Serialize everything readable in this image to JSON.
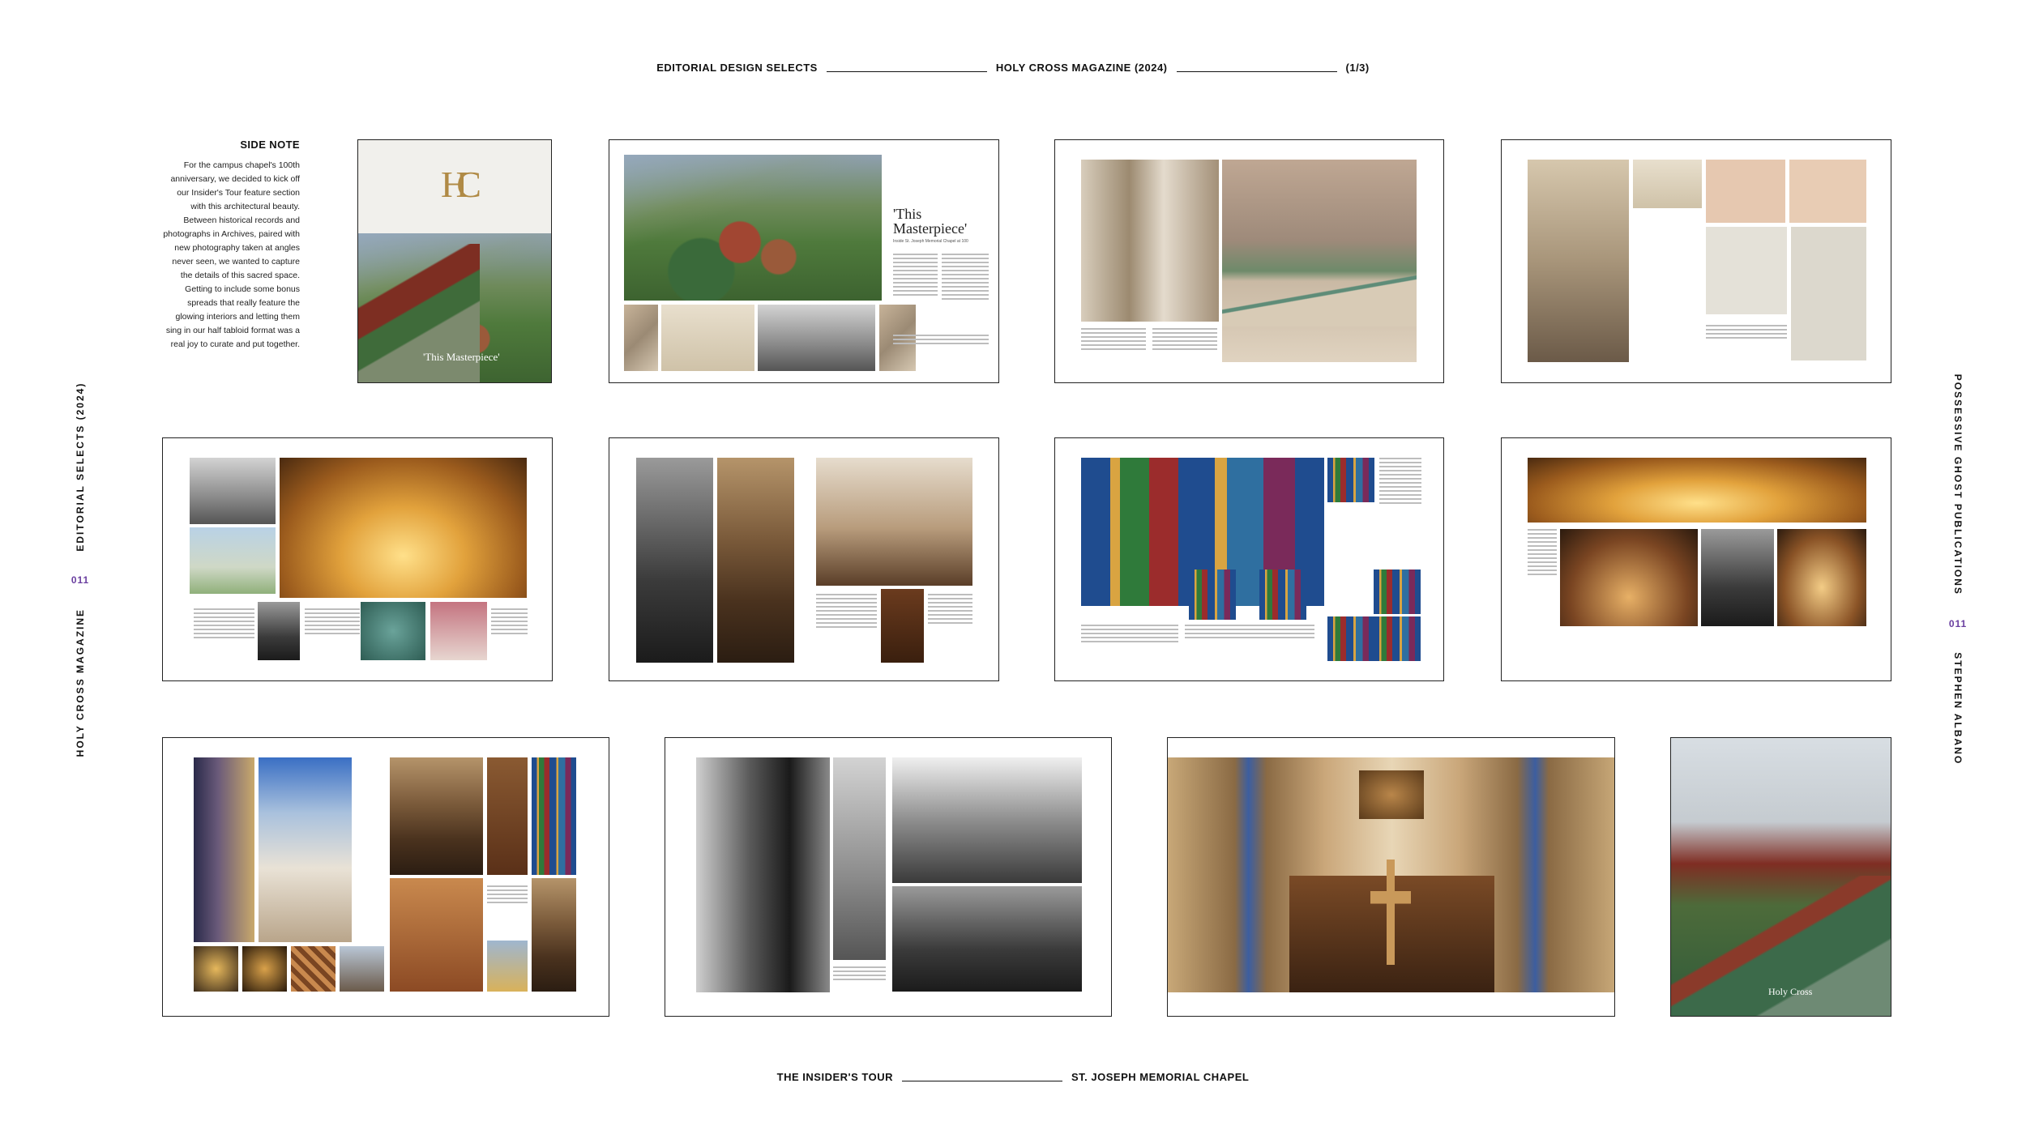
{
  "header": {
    "left": "EDITORIAL DESIGN SELECTS",
    "center": "HOLY CROSS MAGAZINE (2024)",
    "right": "(1/3)"
  },
  "footer": {
    "left": "THE INSIDER'S TOUR",
    "right": "ST. JOSEPH MEMORIAL CHAPEL"
  },
  "side_left": {
    "label_a": "HOLY CROSS MAGAZINE",
    "page": "011",
    "label_b": "EDITORIAL SELECTS (2024)"
  },
  "side_right": {
    "label_a": "POSSESSIVE GHOST PUBLICATIONS",
    "page": "011",
    "label_b": "STEPHEN ALBANO"
  },
  "sidenote": {
    "title": "SIDE NOTE",
    "body": "For the campus chapel's 100th anniversary, we decided to kick off our Insider's Tour feature section with this architectural beauty. Between historical records and photographs in Archives, paired with new photography taken at angles never seen, we wanted to capture the details of this sacred space. Getting to include some bonus spreads that really feature the glowing interiors and letting them sing in our half tabloid format was a real joy to curate and put together."
  },
  "spreads": {
    "cover_title": "'This Masterpiece'",
    "cover_monogram": "HC",
    "opener_title": "'This Masterpiece'",
    "opener_subtitle": "Inside St. Joseph Memorial Chapel at 100",
    "back_cover_title": "Holy Cross"
  }
}
